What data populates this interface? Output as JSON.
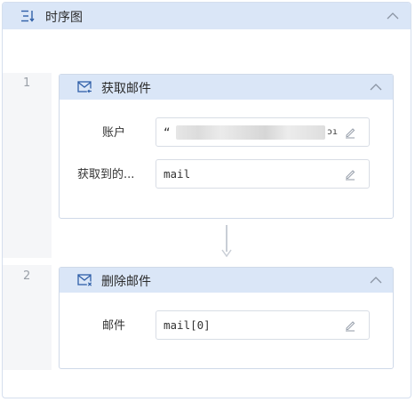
{
  "header": {
    "title": "时序图",
    "icon": "timeline-icon"
  },
  "steps": [
    {
      "index": "1",
      "title": "获取邮件",
      "icon": "mail-receive-icon",
      "fields": [
        {
          "label": "账户",
          "value": "“",
          "value_suffix": "ɔı"
        },
        {
          "label": "获取到的...",
          "value": "mail"
        }
      ]
    },
    {
      "index": "2",
      "title": "删除邮件",
      "icon": "mail-delete-icon",
      "fields": [
        {
          "label": "邮件",
          "value": "mail[0]"
        }
      ]
    }
  ],
  "colors": {
    "header_bg": "#dae6f7",
    "border": "#d5dfee",
    "accent": "#2f5fa8"
  }
}
